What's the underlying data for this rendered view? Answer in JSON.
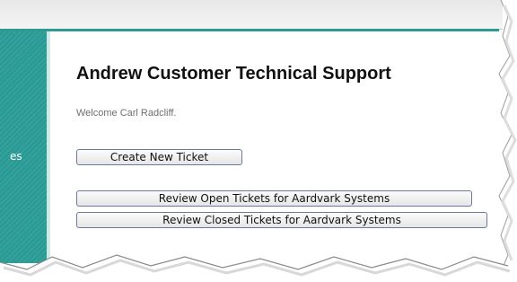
{
  "sidebar": {
    "fragment_text": "es"
  },
  "main": {
    "title": "Andrew Customer Technical Support",
    "welcome": "Welcome Carl Radcliff.",
    "buttons": {
      "create": "Create New Ticket",
      "review_open": "Review Open Tickets for Aardvark Systems",
      "review_closed": "Review Closed Tickets for Aardvark Systems"
    }
  },
  "colors": {
    "sidebar": "#2a9b94",
    "accent_line": "#2e9b93",
    "button_border": "#6b7a99"
  }
}
